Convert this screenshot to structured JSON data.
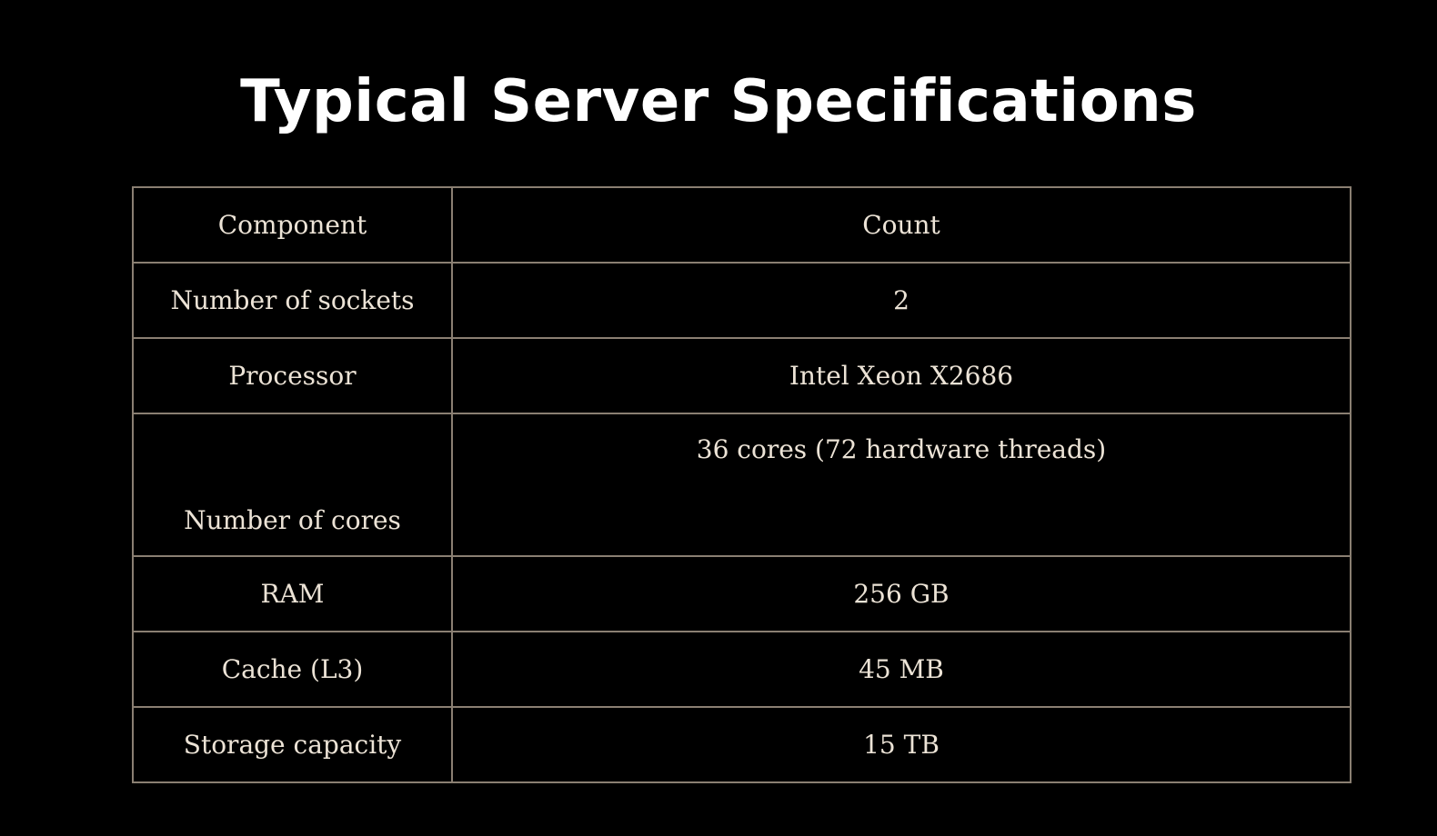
{
  "title": "Typical Server Specifications",
  "table": {
    "headers": [
      "Component",
      "Count"
    ],
    "rows": [
      [
        "Number of sockets",
        "2"
      ],
      [
        "Processor",
        "Intel Xeon X2686"
      ],
      [
        "Number of cores",
        "36 cores (72 hardware threads)"
      ],
      [
        "RAM",
        "256 GB"
      ],
      [
        "Cache (L3)",
        "45 MB"
      ],
      [
        "Storage capacity",
        "15 TB"
      ]
    ]
  }
}
